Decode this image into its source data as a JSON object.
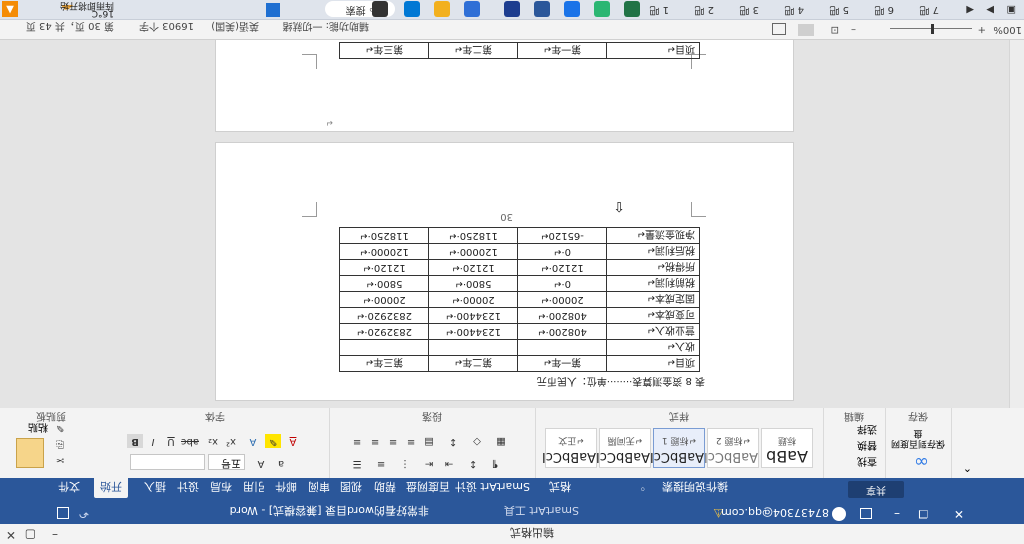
{
  "title_bar": {
    "center_title": "输出格式",
    "minimize": "–",
    "restore": "▢",
    "close": "✕"
  },
  "quick_access": {
    "doc_title": "非常好看的word目录 [兼容模式] - Word",
    "tools_label": "SmartArt 工具",
    "account": "87437304@qq.com",
    "save_icon": "save-icon",
    "undo_icon": "undo-icon"
  },
  "tabs": [
    "文件",
    "开始",
    "插入",
    "设计",
    "布局",
    "引用",
    "邮件",
    "审阅",
    "视图",
    "帮助",
    "百度网盘",
    "SmartArt 设计",
    "格式"
  ],
  "tell_me": "操作说明搜索",
  "share_label": "共享",
  "ribbon": {
    "groups": [
      "剪贴板",
      "字体",
      "段落",
      "样式",
      "编辑",
      "保存"
    ],
    "paste_label": "粘贴",
    "font_size": "五号",
    "styles": [
      {
        "sample": "AaBbCcI",
        "name": "↵正文"
      },
      {
        "sample": "AaBbCcI",
        "name": "↵无间隔"
      },
      {
        "sample": "AaBbCcI",
        "name": "↵标题 1"
      },
      {
        "sample": "AaBbCcI",
        "name": "↵标题 2"
      },
      {
        "sample": "AaBb",
        "name": "标题"
      }
    ],
    "edit_items": [
      "查找",
      "替换",
      "选择"
    ],
    "save_label": "保存到百度网盘"
  },
  "document": {
    "page1_header": [
      "项目↵",
      "第一年↵",
      "第二年↵",
      "第三年↵"
    ],
    "page2_caption": "表 8 资金测算表········单位：人民币元",
    "page_marker": "30",
    "table": {
      "header": [
        "项目↵",
        "第一年↵",
        "第二年↵",
        "第三年↵"
      ],
      "rows": [
        [
          "收入↵",
          "",
          "",
          ""
        ],
        [
          "营业收入↵",
          "408200·↵",
          "1234400·↵",
          "2832920·↵"
        ],
        [
          "可变成本↵",
          "408200·↵",
          "1234400·↵",
          "2832920·↵"
        ],
        [
          "固定成本↵",
          "20000·↵",
          "20000·↵",
          "20000·↵"
        ],
        [
          "税前利润↵",
          "0·↵",
          "5800·↵",
          "5800·↵"
        ],
        [
          "所得税↵",
          "12120·↵",
          "12120·↵",
          "12120·↵"
        ],
        [
          "税后利润↵",
          "0·↵",
          "120000·↵",
          "120000·↵"
        ],
        [
          "净现金流量↵",
          "-65120↵",
          "118250·↵",
          "118250·↵"
        ]
      ]
    }
  },
  "status_bar": {
    "page": "第 30 页，共 43 页",
    "words": "16903 个字",
    "language": "英语(美国)",
    "accessibility": "辅助功能: 一切就绪",
    "zoom": "100%",
    "zoom_minus": "–",
    "zoom_plus": "+"
  },
  "taskbar": {
    "search": "搜索",
    "weather": "16°C",
    "weather_sub": "阵雨即将开始",
    "page_tabs": [
      "1 吧",
      "2 吧",
      "3 吧",
      "4 吧",
      "5 吧",
      "6 吧",
      "7 吧"
    ],
    "app_colors": [
      "#0078d4",
      "#f2b01e",
      "#2f6fd6",
      "#1d3d8f",
      "#2b579a",
      "#1a73e8",
      "#2bb673",
      "#217346",
      "#3c8ce7"
    ]
  }
}
